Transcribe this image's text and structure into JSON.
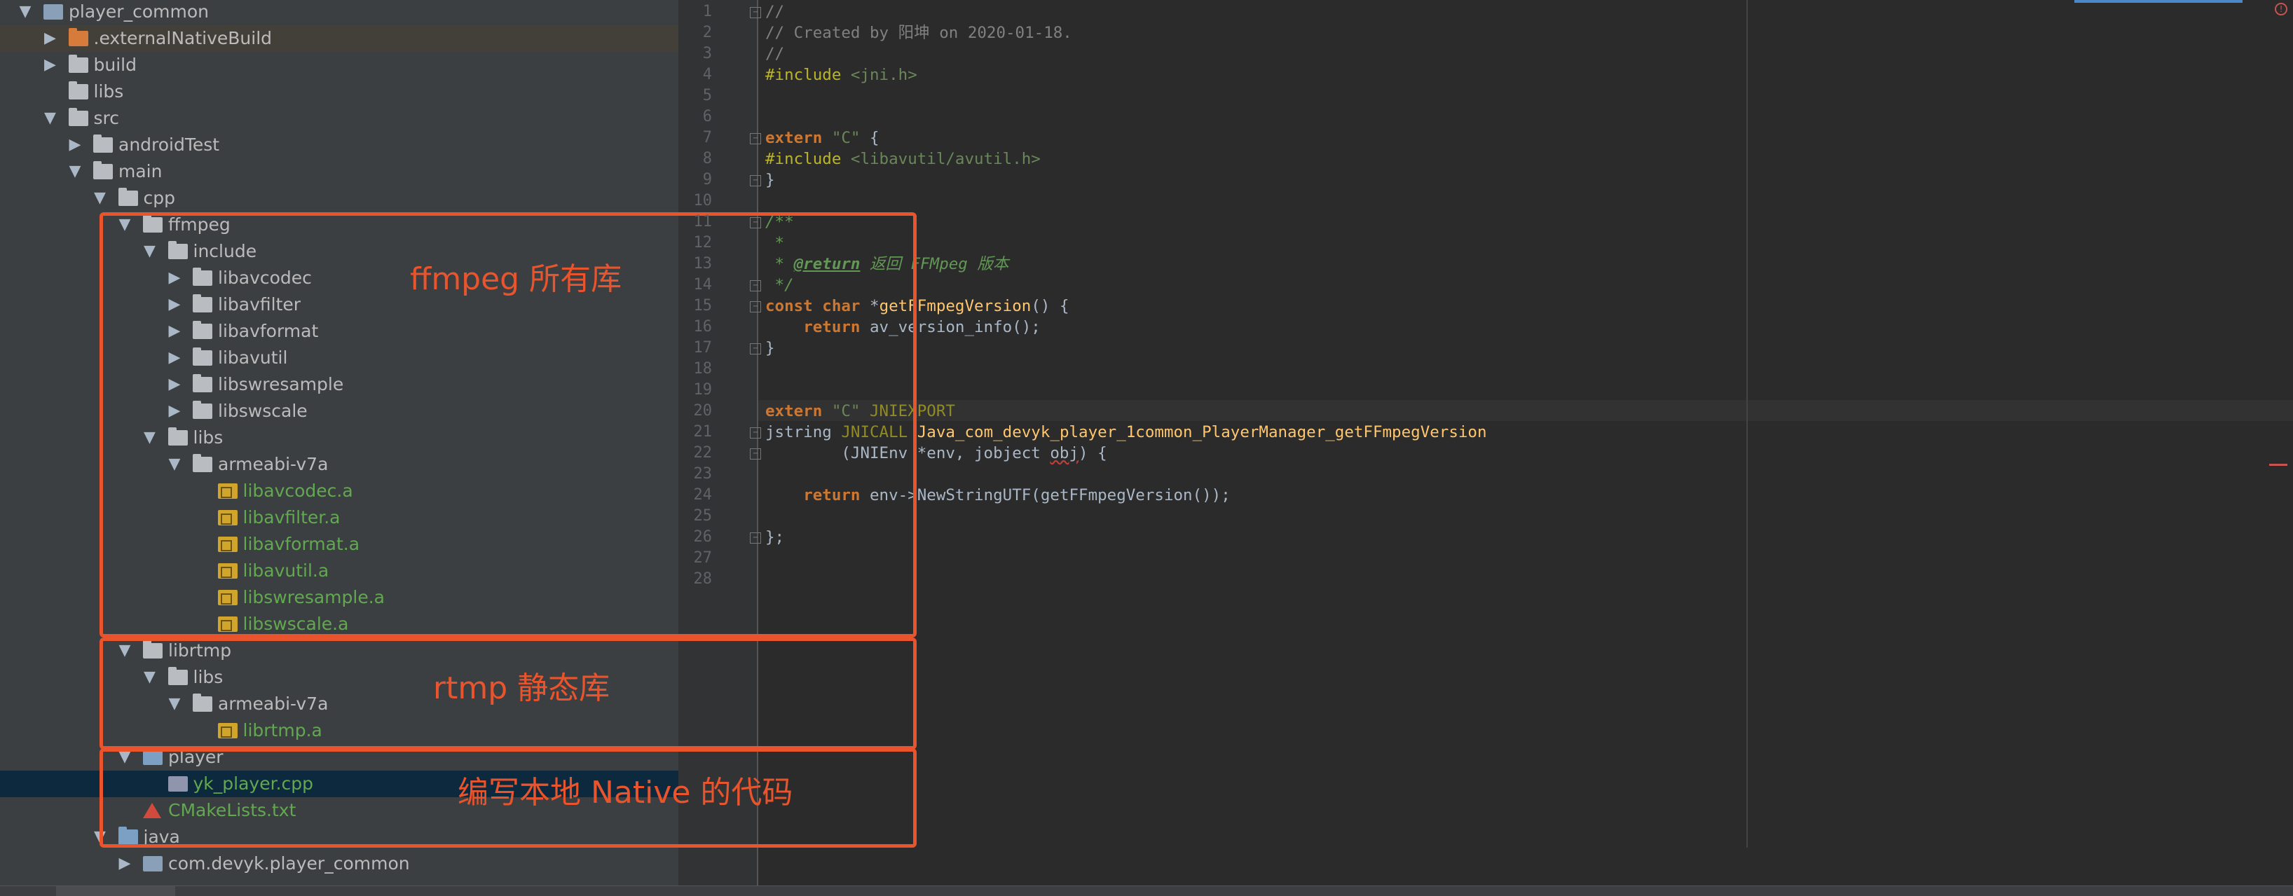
{
  "tree": {
    "rows": [
      {
        "label": "player_common",
        "depth": 0,
        "arrow": "▼",
        "icon": "module-icon",
        "color": "default",
        "state": "normal"
      },
      {
        "label": ".externalNativeBuild",
        "depth": 1,
        "arrow": "▶",
        "icon": "folder-orange-icon",
        "color": "default",
        "state": "highlight"
      },
      {
        "label": "build",
        "depth": 1,
        "arrow": "▶",
        "icon": "folder-icon",
        "color": "default",
        "state": "normal"
      },
      {
        "label": "libs",
        "depth": 1,
        "arrow": "",
        "icon": "folder-icon",
        "color": "default",
        "state": "normal"
      },
      {
        "label": "src",
        "depth": 1,
        "arrow": "▼",
        "icon": "folder-icon",
        "color": "default",
        "state": "normal"
      },
      {
        "label": "androidTest",
        "depth": 2,
        "arrow": "▶",
        "icon": "folder-icon",
        "color": "default",
        "state": "normal"
      },
      {
        "label": "main",
        "depth": 2,
        "arrow": "▼",
        "icon": "folder-icon",
        "color": "default",
        "state": "normal"
      },
      {
        "label": "cpp",
        "depth": 3,
        "arrow": "▼",
        "icon": "folder-icon",
        "color": "default",
        "state": "normal"
      },
      {
        "label": "ffmpeg",
        "depth": 4,
        "arrow": "▼",
        "icon": "folder-icon",
        "color": "default",
        "state": "normal"
      },
      {
        "label": "include",
        "depth": 5,
        "arrow": "▼",
        "icon": "folder-icon",
        "color": "default",
        "state": "normal"
      },
      {
        "label": "libavcodec",
        "depth": 6,
        "arrow": "▶",
        "icon": "folder-icon",
        "color": "default",
        "state": "normal"
      },
      {
        "label": "libavfilter",
        "depth": 6,
        "arrow": "▶",
        "icon": "folder-icon",
        "color": "default",
        "state": "normal"
      },
      {
        "label": "libavformat",
        "depth": 6,
        "arrow": "▶",
        "icon": "folder-icon",
        "color": "default",
        "state": "normal"
      },
      {
        "label": "libavutil",
        "depth": 6,
        "arrow": "▶",
        "icon": "folder-icon",
        "color": "default",
        "state": "normal"
      },
      {
        "label": "libswresample",
        "depth": 6,
        "arrow": "▶",
        "icon": "folder-icon",
        "color": "default",
        "state": "normal"
      },
      {
        "label": "libswscale",
        "depth": 6,
        "arrow": "▶",
        "icon": "folder-icon",
        "color": "default",
        "state": "normal"
      },
      {
        "label": "libs",
        "depth": 5,
        "arrow": "▼",
        "icon": "folder-icon",
        "color": "default",
        "state": "normal"
      },
      {
        "label": "armeabi-v7a",
        "depth": 6,
        "arrow": "▼",
        "icon": "folder-icon",
        "color": "default",
        "state": "normal"
      },
      {
        "label": "libavcodec.a",
        "depth": 7,
        "arrow": "",
        "icon": "library-file-icon",
        "color": "green",
        "state": "normal"
      },
      {
        "label": "libavfilter.a",
        "depth": 7,
        "arrow": "",
        "icon": "library-file-icon",
        "color": "green",
        "state": "normal"
      },
      {
        "label": "libavformat.a",
        "depth": 7,
        "arrow": "",
        "icon": "library-file-icon",
        "color": "green",
        "state": "normal"
      },
      {
        "label": "libavutil.a",
        "depth": 7,
        "arrow": "",
        "icon": "library-file-icon",
        "color": "green",
        "state": "normal"
      },
      {
        "label": "libswresample.a",
        "depth": 7,
        "arrow": "",
        "icon": "library-file-icon",
        "color": "green",
        "state": "normal"
      },
      {
        "label": "libswscale.a",
        "depth": 7,
        "arrow": "",
        "icon": "library-file-icon",
        "color": "green",
        "state": "normal"
      },
      {
        "label": "librtmp",
        "depth": 4,
        "arrow": "▼",
        "icon": "folder-icon",
        "color": "default",
        "state": "normal"
      },
      {
        "label": "libs",
        "depth": 5,
        "arrow": "▼",
        "icon": "folder-icon",
        "color": "default",
        "state": "normal"
      },
      {
        "label": "armeabi-v7a",
        "depth": 6,
        "arrow": "▼",
        "icon": "folder-icon",
        "color": "default",
        "state": "normal"
      },
      {
        "label": "librtmp.a",
        "depth": 7,
        "arrow": "",
        "icon": "library-file-icon",
        "color": "green",
        "state": "normal"
      },
      {
        "label": "player",
        "depth": 4,
        "arrow": "▼",
        "icon": "folder-blue-icon",
        "color": "default",
        "state": "normal"
      },
      {
        "label": "yk_player.cpp",
        "depth": 5,
        "arrow": "",
        "icon": "cpp-file-icon",
        "color": "green",
        "state": "selected"
      },
      {
        "label": "CMakeLists.txt",
        "depth": 4,
        "arrow": "",
        "icon": "cmake-icon",
        "color": "green",
        "state": "normal"
      },
      {
        "label": "java",
        "depth": 3,
        "arrow": "▼",
        "icon": "folder-blue-icon",
        "color": "default",
        "state": "normal"
      },
      {
        "label": "com.devyk.player_common",
        "depth": 4,
        "arrow": "▶",
        "icon": "package-icon",
        "color": "default",
        "state": "normal"
      }
    ]
  },
  "editor": {
    "line_numbers": [
      "1",
      "2",
      "3",
      "4",
      "5",
      "6",
      "7",
      "8",
      "9",
      "10",
      "11",
      "12",
      "13",
      "14",
      "15",
      "16",
      "17",
      "18",
      "19",
      "20",
      "21",
      "22",
      "23",
      "24",
      "25",
      "26",
      "27",
      "28"
    ],
    "lines": [
      [
        [
          "cm",
          "//"
        ]
      ],
      [
        [
          "cm",
          "// Created by 阳坤 on 2020-01-18."
        ]
      ],
      [
        [
          "cm",
          "//"
        ]
      ],
      [
        [
          "pp",
          "#include "
        ],
        [
          "st",
          "<jni.h>"
        ]
      ],
      [],
      [],
      [
        [
          "kw",
          "extern "
        ],
        [
          "st",
          "\"C\" "
        ],
        [
          "",
          "{"
        ]
      ],
      [
        [
          "pp",
          "#include "
        ],
        [
          "st",
          "<libavutil/avutil.h>"
        ]
      ],
      [
        [
          "",
          "}"
        ]
      ],
      [],
      [
        [
          "dc",
          "/**"
        ]
      ],
      [
        [
          "dc",
          " *"
        ]
      ],
      [
        [
          "dc",
          " * "
        ],
        [
          "dt",
          "@return"
        ],
        [
          "dc",
          " 返回 FFMpeg 版本"
        ]
      ],
      [
        [
          "dc",
          " */"
        ]
      ],
      [
        [
          "kw",
          "const char "
        ],
        [
          "",
          "*"
        ],
        [
          "fn",
          "getFFmpegVersion"
        ],
        [
          "",
          "() {"
        ]
      ],
      [
        [
          "",
          "    "
        ],
        [
          "kw",
          "return "
        ],
        [
          "",
          "av_version_info();"
        ]
      ],
      [
        [
          "",
          "}"
        ]
      ],
      [],
      [],
      [
        [
          "kw",
          "extern "
        ],
        [
          "st",
          "\"C\" "
        ],
        [
          "mc",
          "JNIEXPORT"
        ]
      ],
      [
        [
          "",
          "jstring "
        ],
        [
          "mc",
          "JNICALL "
        ],
        [
          "fn",
          "Java_com_devyk_player_1common_PlayerManager_getFFmpegVersion"
        ]
      ],
      [
        [
          "",
          "        (JNIEnv *env, jobject "
        ],
        [
          "un",
          "obj"
        ],
        [
          "",
          ") {"
        ]
      ],
      [],
      [
        [
          "",
          "    "
        ],
        [
          "kw",
          "return "
        ],
        [
          "",
          "env->NewStringUTF(getFFmpegVersion());"
        ]
      ],
      [],
      [
        [
          "",
          "};"
        ]
      ],
      [],
      []
    ]
  },
  "annotations": {
    "ffmpeg": "ffmpeg 所有库",
    "rtmp": "rtmp 静态库",
    "native": "编写本地 Native 的代码"
  },
  "colors": {
    "annotation": "#e9542d",
    "selection": "#0d293e"
  }
}
